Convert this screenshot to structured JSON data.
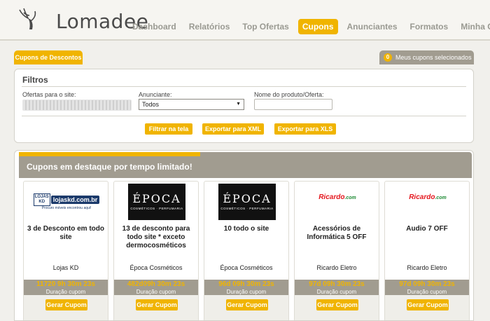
{
  "header": {
    "logo_text": "Lomadee",
    "nav": [
      "Dashboard",
      "Relatórios",
      "Top Ofertas",
      "Cupons",
      "Anunciantes",
      "Formatos",
      "Minha Conta"
    ],
    "active_nav": "Cupons"
  },
  "tabs": {
    "left": "Cupons de Descontos",
    "selected_count": "0",
    "selected_label": "Meus cupons selecionados"
  },
  "filters": {
    "title": "Filtros",
    "site_label": "Ofertas para o site:",
    "site_value": "",
    "advertiser_label": "Anunciante:",
    "advertiser_value": "Todos",
    "product_label": "Nome do produto/Oferta:",
    "product_value": "",
    "buttons": [
      "Filtrar na tela",
      "Exportar para XML",
      "Exportar para XLS"
    ]
  },
  "featured": {
    "title": "Cupons em destaque por tempo limitado!",
    "duration_label": "Duração cupom",
    "button_label": "Gerar Cupom",
    "coupons": [
      {
        "logo": "lojaskd-logo",
        "title": "3 de Desconto em todo site",
        "advertiser": "Lojas KD",
        "timer": "11720 9h 30m 23s"
      },
      {
        "logo": "epoca-logo",
        "title": "13 de desconto para todo site * exceto dermocosméticos",
        "advertiser": "Época Cosméticos",
        "timer": "482d09h 30m 23s"
      },
      {
        "logo": "epoca-logo",
        "title": "10 todo o site",
        "advertiser": "Época Cosméticos",
        "timer": "96d 09h 30m 23s"
      },
      {
        "logo": "ricardo-logo",
        "title": "Acessórios de Informática 5 OFF",
        "advertiser": "Ricardo Eletro",
        "timer": "97d 09h 30m 23s"
      },
      {
        "logo": "ricardo-logo",
        "title": "Audio 7 OFF",
        "advertiser": "Ricardo Eletro",
        "timer": "97d 09h 30m 23s"
      }
    ]
  },
  "logos": {
    "lojaskd_badge": "LOJAS KD",
    "lojaskd_box": "lojaskd.com.br",
    "lojaskd_tagline": "Procuro móveis encontrou aqui!",
    "epoca_name": "ÉPOCA",
    "epoca_sub": "COSMÉTICOS · PERFUMARIA",
    "ricardo_name": "Ricardo",
    "ricardo_suffix": ".com"
  },
  "colors": {
    "accent": "#f0b400",
    "panel_gray": "#a19c90",
    "background": "#f1f0ec"
  }
}
